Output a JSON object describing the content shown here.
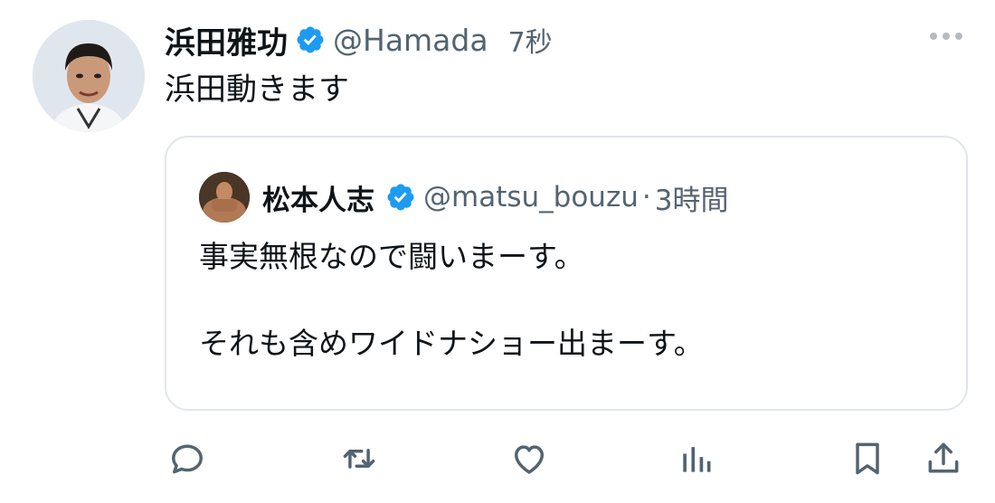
{
  "tweet": {
    "author_name": "浜田雅功",
    "handle": "@Hamada",
    "time": "7秒",
    "text": "浜田動きます",
    "verified_icon": "verified-badge-icon",
    "more_icon": "more-options-icon"
  },
  "quote": {
    "author_name": "松本人志",
    "handle": "@matsu_bouzu",
    "separator": "·",
    "time": "3時間",
    "lines": [
      "事実無根なので闘いまーす。",
      "",
      "それも含めワイドナショー出まーす。"
    ]
  },
  "actions": [
    {
      "icon": "reply-icon"
    },
    {
      "icon": "retweet-icon"
    },
    {
      "icon": "like-icon"
    },
    {
      "icon": "views-icon"
    },
    {
      "icon": "bookmark-icon"
    },
    {
      "icon": "share-icon"
    }
  ],
  "colors": {
    "verified": "#1d9bf0",
    "secondary_text": "#536471",
    "border": "#e1e6ea",
    "icon": "#536471"
  }
}
